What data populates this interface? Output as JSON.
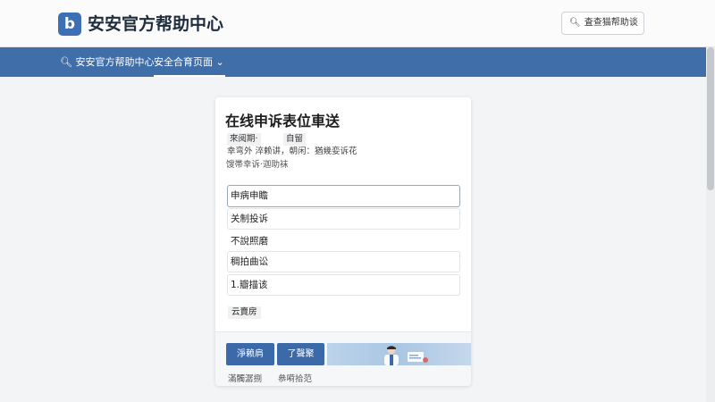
{
  "header": {
    "logo_icon": "b",
    "brand": "安安官方帮助中心",
    "search_placeholder": "査查猫帮助谈"
  },
  "nav": {
    "home_label": "安安官方帮助中心",
    "menu_label": "安全合育页面",
    "accent_color": "#3f6ea8"
  },
  "form": {
    "title": "在线申诉表位車送",
    "meta_a": "來阅期·",
    "meta_b": "自留",
    "meta_line": "幸弯外 淬赖讲，朝闲：猶幾娈诉花",
    "meta_sub": "馊帯幸诉·迦助袜",
    "fields": [
      {
        "value": "申病申瞻"
      },
      {
        "value": "关制投诉"
      },
      {
        "value": "不說照磨"
      },
      {
        "value": "稠拍曲讼"
      },
      {
        "value": "1.瓣描该"
      }
    ],
    "file_button": "云賣房"
  },
  "footer": {
    "submit_label": "淨赖肩",
    "reset_label": "了聲聚",
    "link_1": "滿髑潺捌",
    "link_2": "叅嗬拾范"
  }
}
